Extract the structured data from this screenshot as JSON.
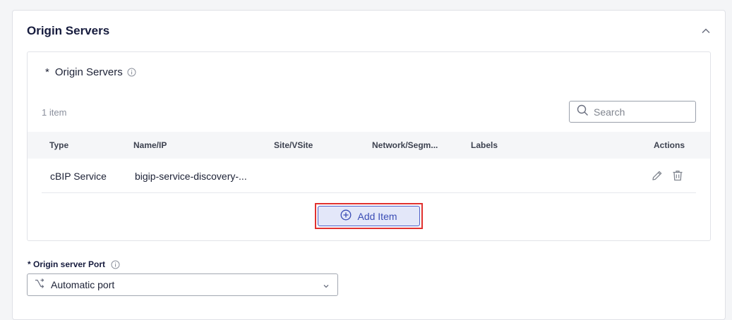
{
  "section": {
    "title": "Origin Servers"
  },
  "origin_list": {
    "title": "Origin Servers",
    "required_mark": "*",
    "count_text": "1 item",
    "search": {
      "placeholder": "Search"
    },
    "columns": [
      "Type",
      "Name/IP",
      "Site/VSite",
      "Network/Segm...",
      "Labels",
      "Actions"
    ],
    "rows": [
      {
        "type": "cBIP Service",
        "name": "bigip-service-discovery-..."
      }
    ],
    "add_button": "Add Item"
  },
  "port_field": {
    "required_mark": "*",
    "label": "Origin server Port",
    "value": "Automatic port"
  },
  "colors": {
    "accent": "#3b4db5",
    "highlight": "#e0312f",
    "title": "#161b3d"
  }
}
